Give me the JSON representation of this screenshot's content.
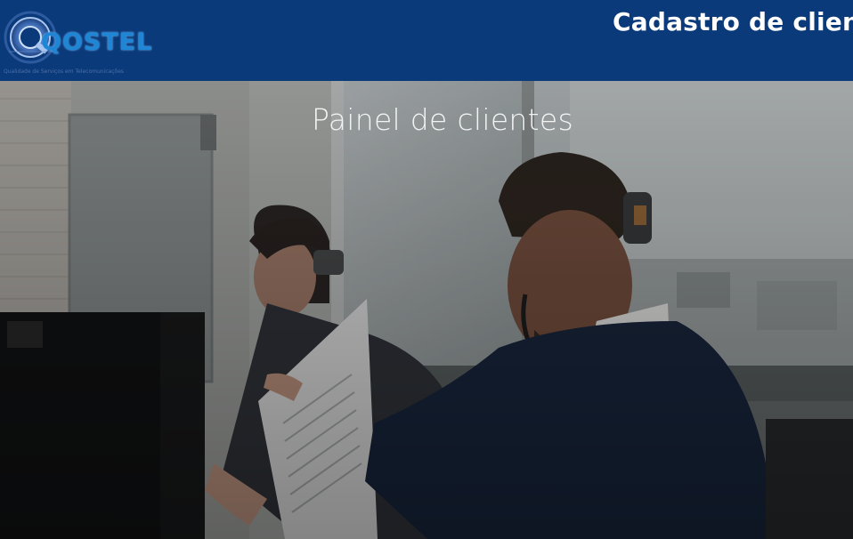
{
  "header": {
    "logo_text": "QOSTEL",
    "logo_tagline": "Qualidade de Serviços em Telecomunicações",
    "page_heading": "Cadastro de client",
    "bg_color": "#0b3a7a"
  },
  "hero": {
    "title": "Painel de clientes",
    "image_description_icon": "call-center-photo"
  }
}
